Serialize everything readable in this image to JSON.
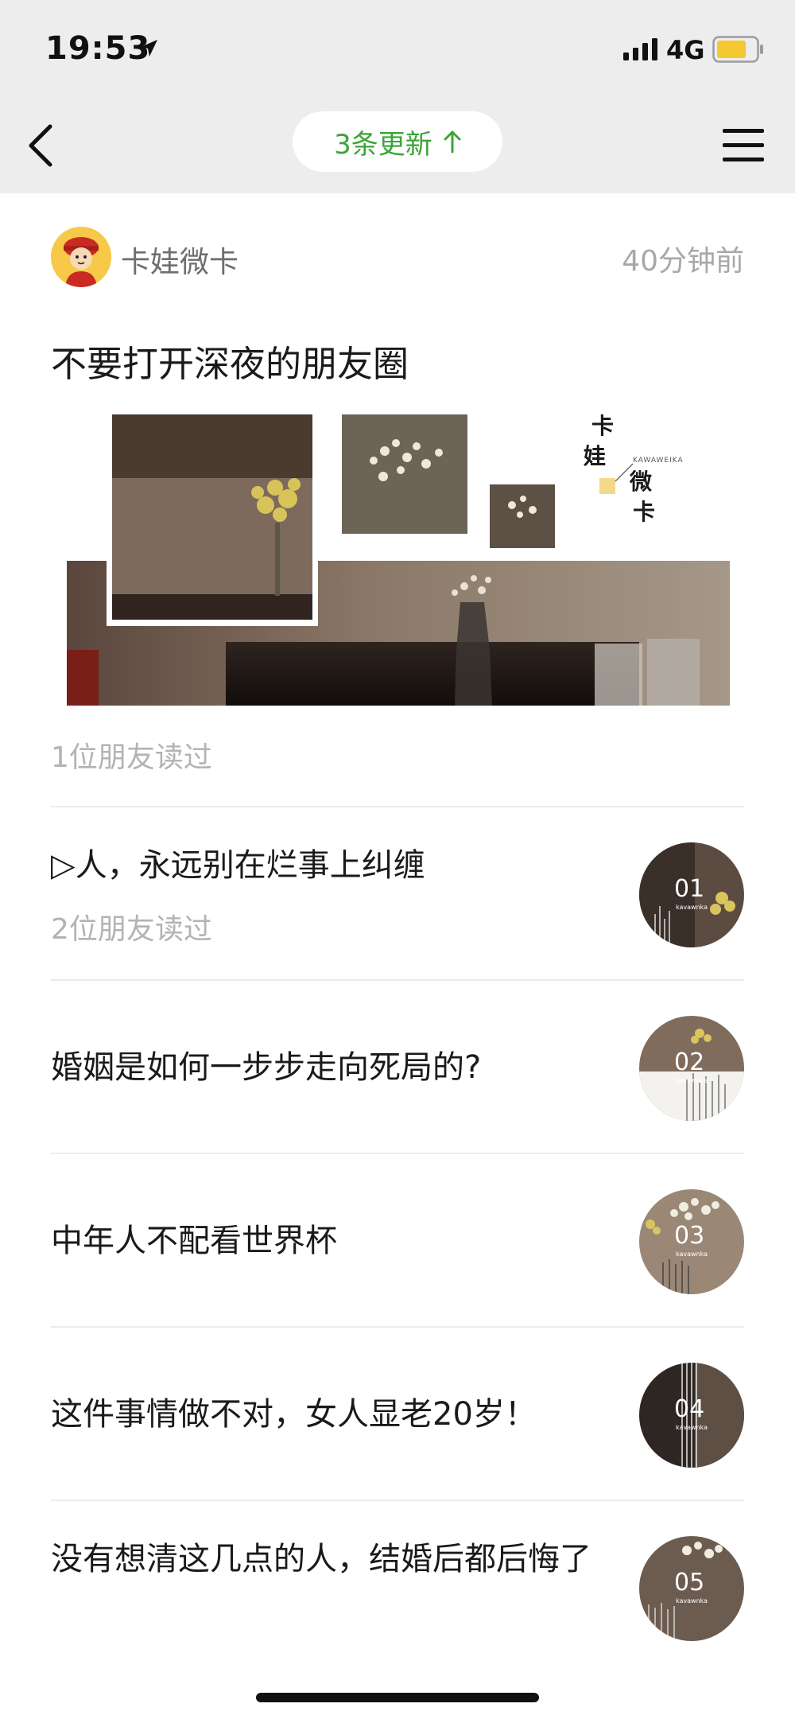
{
  "status": {
    "time": "19:53",
    "network": "4G",
    "location_icon": "location-arrow-icon",
    "signal_icon": "signal-bars-icon",
    "battery_icon": "battery-icon"
  },
  "nav": {
    "back_icon": "chevron-left-icon",
    "update_label": "3条更新",
    "update_icon": "arrow-up-icon",
    "menu_icon": "menu-icon"
  },
  "account": {
    "name": "卡娃微卡",
    "time_ago": "40分钟前"
  },
  "main_article": {
    "title": "不要打开深夜的朋友圈",
    "readers": "1位朋友读过",
    "cover": {
      "text_1": "卡",
      "text_2": "娃",
      "text_3": "微",
      "text_4": "卡",
      "brand": "KAWAWEIKA"
    }
  },
  "articles": [
    {
      "title": "▷人，永远别在烂事上纠缠",
      "readers": "2位朋友读过",
      "thumb_num": "01",
      "thumb_brand": "kavawnka"
    },
    {
      "title": "婚姻是如何一步步走向死局的?",
      "readers": "",
      "thumb_num": "02",
      "thumb_brand": "kavawnka"
    },
    {
      "title": "中年人不配看世界杯",
      "readers": "",
      "thumb_num": "03",
      "thumb_brand": "kavawnka"
    },
    {
      "title": "这件事情做不对，女人显老20岁！",
      "readers": "",
      "thumb_num": "04",
      "thumb_brand": "kavawnka"
    },
    {
      "title": "没有想清这几点的人，结婚后都后悔了",
      "readers": "",
      "thumb_num": "05",
      "thumb_brand": "kavawnka"
    }
  ],
  "colors": {
    "accent_green": "#3aa535",
    "header_bg": "#ededed",
    "muted_text": "#b3b3b3"
  }
}
